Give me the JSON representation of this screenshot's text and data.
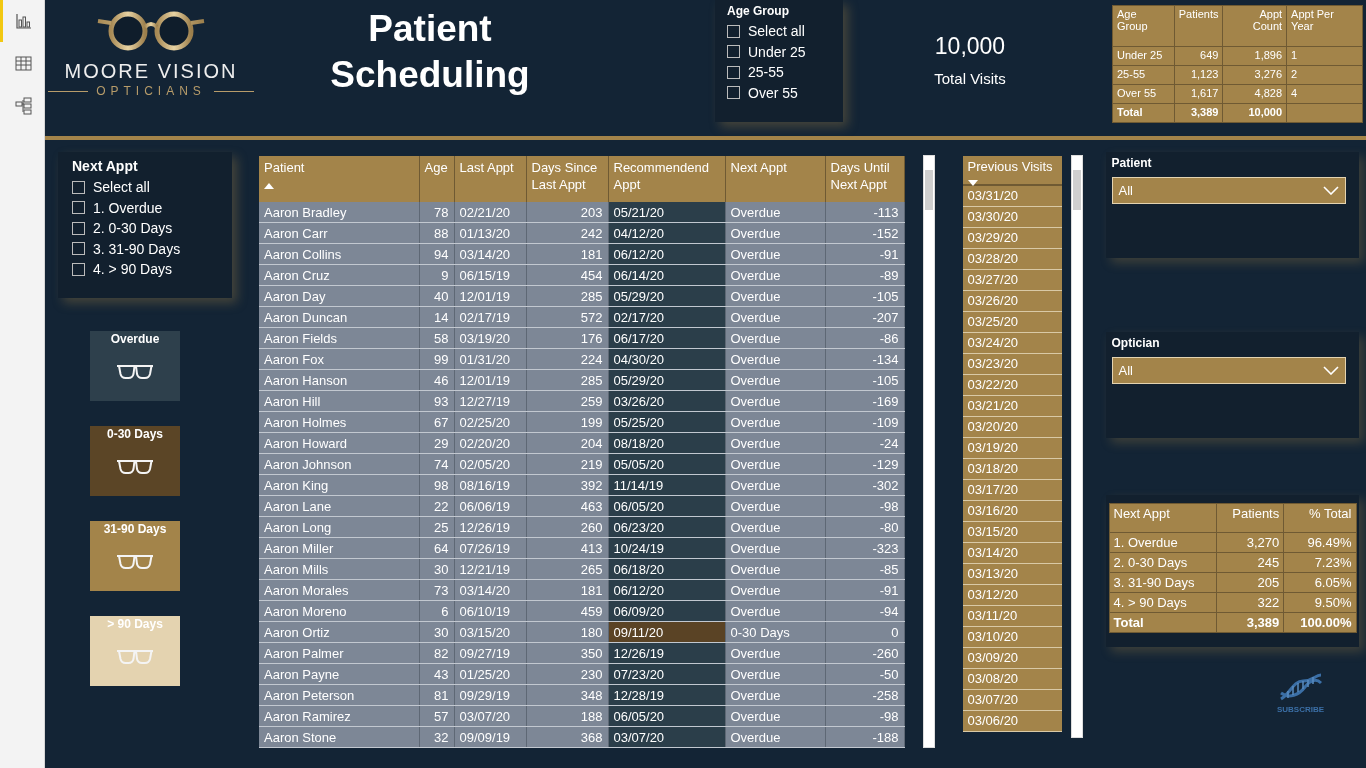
{
  "sidebar": {
    "items": [
      {
        "selected": true
      },
      {
        "selected": false
      },
      {
        "selected": false
      }
    ]
  },
  "header": {
    "logo": {
      "name": "MOORE VISION",
      "tagline": "OPTICIANS"
    },
    "title": "Patient Scheduling",
    "age_slicer": {
      "title": "Age Group",
      "items": [
        {
          "label": "Select all",
          "checked": false
        },
        {
          "label": "Under 25",
          "checked": false
        },
        {
          "label": "25-55",
          "checked": false
        },
        {
          "label": "Over 55",
          "checked": false
        }
      ]
    },
    "card": {
      "value": "10,000",
      "label": "Total Visits"
    },
    "age_table": {
      "columns": [
        {
          "label": "Age Group",
          "kind": "text"
        },
        {
          "label": "Patients",
          "kind": "number"
        },
        {
          "label": "Appt Count",
          "kind": "number"
        },
        {
          "label": "Appt Per Year",
          "kind": "text"
        }
      ],
      "rows": [
        {
          "kind": "data",
          "cells": [
            "Under 25",
            "649",
            "1,896",
            "1"
          ]
        },
        {
          "kind": "data",
          "cells": [
            "25-55",
            "1,123",
            "3,276",
            "2"
          ]
        },
        {
          "kind": "data",
          "cells": [
            "Over 55",
            "1,617",
            "4,828",
            "4"
          ]
        },
        {
          "kind": "total",
          "cells": [
            "Total",
            "3,389",
            "10,000"
          ]
        }
      ]
    }
  },
  "next_appt_slicer": {
    "title": "Next Appt",
    "items": [
      {
        "label": "Select all",
        "checked": false
      },
      {
        "label": "1. Overdue",
        "checked": false
      },
      {
        "label": "2. 0-30 Days",
        "checked": false
      },
      {
        "label": "3. 31-90 Days",
        "checked": false
      },
      {
        "label": "4. > 90 Days",
        "checked": false
      }
    ]
  },
  "legend": [
    {
      "label": "Overdue",
      "color": "#2e404c"
    },
    {
      "label": "0-30 Days",
      "color": "#5b4526"
    },
    {
      "label": "31-90 Days",
      "color": "#a3844a"
    },
    {
      "label": "> 90 Days",
      "color": "#e4d3b0"
    }
  ],
  "patients": {
    "columns": [
      {
        "label": "Patient",
        "kind": "text",
        "sort_ascending": true
      },
      {
        "label": "Age",
        "kind": "number"
      },
      {
        "label": "Last Appt",
        "kind": "text"
      },
      {
        "label": "Days Since Last Appt",
        "kind": "number"
      },
      {
        "label": "Recommendend Appt",
        "kind": "text"
      },
      {
        "label": "Next Appt",
        "kind": "text"
      },
      {
        "label": "Days Until Next Appt",
        "kind": "number"
      }
    ],
    "rows": [
      {
        "cells": [
          "Aaron Bradley",
          "78",
          "02/21/20",
          "203",
          "05/21/20",
          "Overdue",
          "-113"
        ],
        "color": "#2b3e4a"
      },
      {
        "cells": [
          "Aaron Carr",
          "88",
          "01/13/20",
          "242",
          "04/12/20",
          "Overdue",
          "-152"
        ],
        "color": "#2b3e4a"
      },
      {
        "cells": [
          "Aaron Collins",
          "94",
          "03/14/20",
          "181",
          "06/12/20",
          "Overdue",
          "-91"
        ],
        "color": "#2b3e4a"
      },
      {
        "cells": [
          "Aaron Cruz",
          "9",
          "06/15/19",
          "454",
          "06/14/20",
          "Overdue",
          "-89"
        ],
        "color": "#2b3e4a"
      },
      {
        "cells": [
          "Aaron Day",
          "40",
          "12/01/19",
          "285",
          "05/29/20",
          "Overdue",
          "-105"
        ],
        "color": "#2b3e4a"
      },
      {
        "cells": [
          "Aaron Duncan",
          "14",
          "02/17/19",
          "572",
          "02/17/20",
          "Overdue",
          "-207"
        ],
        "color": "#2b3e4a"
      },
      {
        "cells": [
          "Aaron Fields",
          "58",
          "03/19/20",
          "176",
          "06/17/20",
          "Overdue",
          "-86"
        ],
        "color": "#2b3e4a"
      },
      {
        "cells": [
          "Aaron Fox",
          "99",
          "01/31/20",
          "224",
          "04/30/20",
          "Overdue",
          "-134"
        ],
        "color": "#2b3e4a"
      },
      {
        "cells": [
          "Aaron Hanson",
          "46",
          "12/01/19",
          "285",
          "05/29/20",
          "Overdue",
          "-105"
        ],
        "color": "#2b3e4a"
      },
      {
        "cells": [
          "Aaron Hill",
          "93",
          "12/27/19",
          "259",
          "03/26/20",
          "Overdue",
          "-169"
        ],
        "color": "#2b3e4a"
      },
      {
        "cells": [
          "Aaron Holmes",
          "67",
          "02/25/20",
          "199",
          "05/25/20",
          "Overdue",
          "-109"
        ],
        "color": "#2b3e4a"
      },
      {
        "cells": [
          "Aaron Howard",
          "29",
          "02/20/20",
          "204",
          "08/18/20",
          "Overdue",
          "-24"
        ],
        "color": "#2b3e4a"
      },
      {
        "cells": [
          "Aaron Johnson",
          "74",
          "02/05/20",
          "219",
          "05/05/20",
          "Overdue",
          "-129"
        ],
        "color": "#2b3e4a"
      },
      {
        "cells": [
          "Aaron King",
          "98",
          "08/16/19",
          "392",
          "11/14/19",
          "Overdue",
          "-302"
        ],
        "color": "#2b3e4a"
      },
      {
        "cells": [
          "Aaron Lane",
          "22",
          "06/06/19",
          "463",
          "06/05/20",
          "Overdue",
          "-98"
        ],
        "color": "#2b3e4a"
      },
      {
        "cells": [
          "Aaron Long",
          "25",
          "12/26/19",
          "260",
          "06/23/20",
          "Overdue",
          "-80"
        ],
        "color": "#2b3e4a"
      },
      {
        "cells": [
          "Aaron Miller",
          "64",
          "07/26/19",
          "413",
          "10/24/19",
          "Overdue",
          "-323"
        ],
        "color": "#2b3e4a"
      },
      {
        "cells": [
          "Aaron Mills",
          "30",
          "12/21/19",
          "265",
          "06/18/20",
          "Overdue",
          "-85"
        ],
        "color": "#2b3e4a"
      },
      {
        "cells": [
          "Aaron Morales",
          "73",
          "03/14/20",
          "181",
          "06/12/20",
          "Overdue",
          "-91"
        ],
        "color": "#2b3e4a"
      },
      {
        "cells": [
          "Aaron Moreno",
          "6",
          "06/10/19",
          "459",
          "06/09/20",
          "Overdue",
          "-94"
        ],
        "color": "#2b3e4a"
      },
      {
        "cells": [
          "Aaron Ortiz",
          "30",
          "03/15/20",
          "180",
          "09/11/20",
          "0-30 Days",
          "0"
        ],
        "color": "#5a4325"
      },
      {
        "cells": [
          "Aaron Palmer",
          "82",
          "09/27/19",
          "350",
          "12/26/19",
          "Overdue",
          "-260"
        ],
        "color": "#2b3e4a"
      },
      {
        "cells": [
          "Aaron Payne",
          "43",
          "01/25/20",
          "230",
          "07/23/20",
          "Overdue",
          "-50"
        ],
        "color": "#2b3e4a"
      },
      {
        "cells": [
          "Aaron Peterson",
          "81",
          "09/29/19",
          "348",
          "12/28/19",
          "Overdue",
          "-258"
        ],
        "color": "#2b3e4a"
      },
      {
        "cells": [
          "Aaron Ramirez",
          "57",
          "03/07/20",
          "188",
          "06/05/20",
          "Overdue",
          "-98"
        ],
        "color": "#2b3e4a"
      },
      {
        "cells": [
          "Aaron Stone",
          "32",
          "09/09/19",
          "368",
          "03/07/20",
          "Overdue",
          "-188"
        ],
        "color": "#2b3e4a"
      }
    ]
  },
  "previous_visits": {
    "title": "Previous Visits",
    "sort_descending": true,
    "rows": [
      "03/31/20",
      "03/30/20",
      "03/29/20",
      "03/28/20",
      "03/27/20",
      "03/26/20",
      "03/25/20",
      "03/24/20",
      "03/23/20",
      "03/22/20",
      "03/21/20",
      "03/20/20",
      "03/19/20",
      "03/18/20",
      "03/17/20",
      "03/16/20",
      "03/15/20",
      "03/14/20",
      "03/13/20",
      "03/12/20",
      "03/11/20",
      "03/10/20",
      "03/09/20",
      "03/08/20",
      "03/07/20",
      "03/06/20"
    ]
  },
  "patient_filter": {
    "label": "Patient",
    "value": "All"
  },
  "optician_filter": {
    "label": "Optician",
    "value": "All"
  },
  "next_appt_table": {
    "columns": [
      {
        "label": "Next Appt",
        "kind": "text"
      },
      {
        "label": "Patients",
        "kind": "number"
      },
      {
        "label": "% Total",
        "kind": "number"
      }
    ],
    "rows": [
      {
        "kind": "data",
        "cells": [
          "1. Overdue",
          "3,270",
          "96.49%"
        ]
      },
      {
        "kind": "data",
        "cells": [
          "2. 0-30 Days",
          "245",
          "7.23%"
        ]
      },
      {
        "kind": "data",
        "cells": [
          "3. 31-90 Days",
          "205",
          "6.05%"
        ]
      },
      {
        "kind": "data",
        "cells": [
          "4. > 90 Days",
          "322",
          "9.50%"
        ]
      },
      {
        "kind": "total",
        "cells": [
          "Total",
          "3,389",
          "100.00%"
        ]
      }
    ]
  },
  "subscribe": {
    "label": "SUBSCRIBE"
  }
}
